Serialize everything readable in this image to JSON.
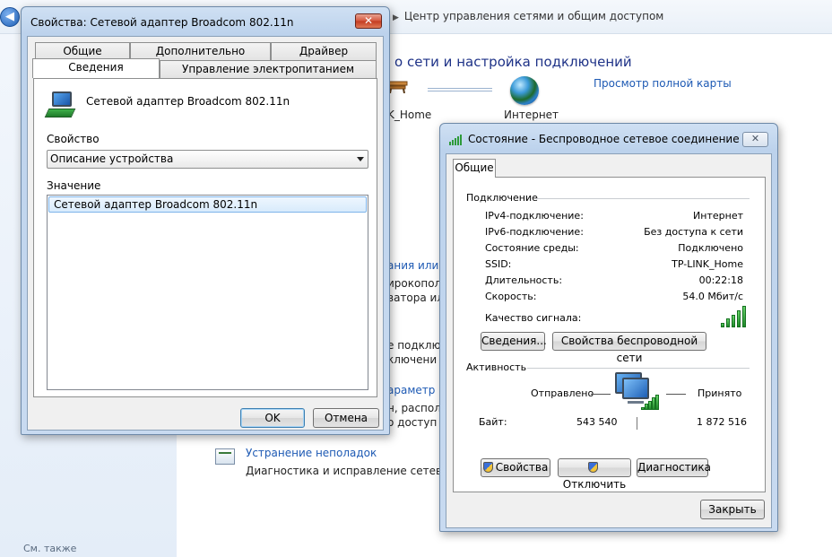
{
  "control_panel": {
    "back_glyph": "◀",
    "breadcrumb_sep": "▶",
    "breadcrumb": "Центр управления сетями и общим доступом",
    "heading": "о сети и настройка подключений",
    "full_map_link": "Просмотр полной карты",
    "home_network": "K_Home",
    "internet": "Интернет",
    "fragments": [
      "ания или се",
      "ирокопол",
      "ватора или",
      "е подклю",
      "ключени",
      "араметр",
      "н, распол",
      "о доступ"
    ],
    "troubleshoot_title": "Устранение неполадок",
    "troubleshoot_desc": "Диагностика и исправление сетевых пр",
    "see_also": "См. также"
  },
  "properties_window": {
    "title": "Свойства: Сетевой адаптер Broadcom 802.11n",
    "close_glyph": "✕",
    "tabs_row1": [
      "Общие",
      "Дополнительно",
      "Драйвер"
    ],
    "tabs_row2": [
      "Сведения",
      "Управление электропитанием"
    ],
    "device_name": "Сетевой адаптер Broadcom 802.11n",
    "property_label": "Свойство",
    "property_value": "Описание устройства",
    "value_label": "Значение",
    "values": [
      "Сетевой адаптер Broadcom 802.11n"
    ],
    "ok": "OK",
    "cancel": "Отмена"
  },
  "status_window": {
    "title": "Состояние - Беспроводное сетевое соединение",
    "close_glyph": "✕",
    "tab": "Общие",
    "connection_header": "Подключение",
    "rows": [
      {
        "label": "IPv4-подключение:",
        "value": "Интернет"
      },
      {
        "label": "IPv6-подключение:",
        "value": "Без доступа к сети"
      },
      {
        "label": "Состояние среды:",
        "value": "Подключено"
      },
      {
        "label": "SSID:",
        "value": "TP-LINK_Home"
      },
      {
        "label": "Длительность:",
        "value": "00:22:18"
      },
      {
        "label": "Скорость:",
        "value": "54.0 Мбит/с"
      }
    ],
    "signal_label": "Качество сигнала:",
    "signal_bars": 5,
    "details_button": "Сведения...",
    "wireless_props_button": "Свойства беспроводной сети",
    "activity_header": "Активность",
    "sent_label": "Отправлено",
    "received_label": "Принято",
    "bytes_label": "Байт:",
    "bytes_sent": "543 540",
    "bytes_received": "1 872 516",
    "properties_button": "Свойства",
    "disable_button": "Отключить",
    "diagnose_button": "Диагностика",
    "close_button": "Закрыть"
  }
}
